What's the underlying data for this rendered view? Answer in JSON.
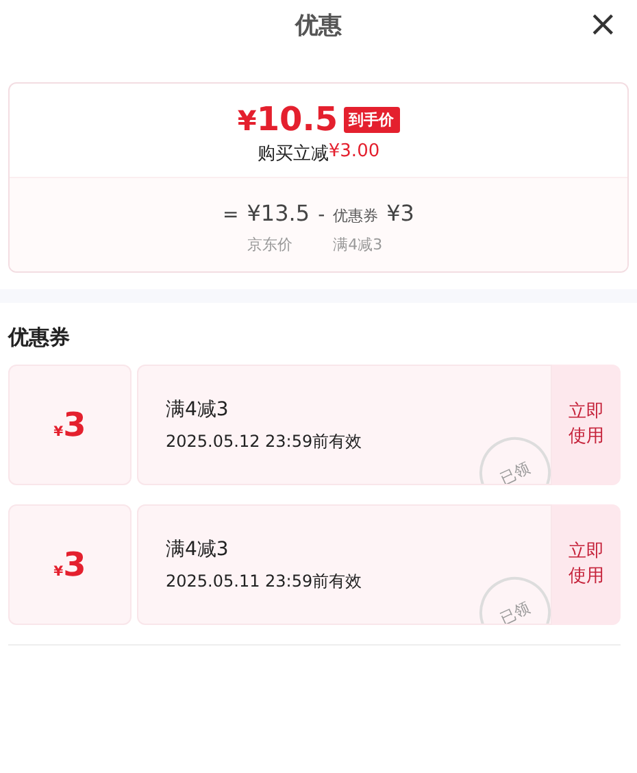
{
  "header": {
    "title": "优惠",
    "close": "×"
  },
  "summary": {
    "currency": "¥",
    "amount": "10.5",
    "badge": "到手价",
    "saving_label": "购买立减",
    "saving_value": "¥3.00",
    "equals": "=",
    "base_price": "¥13.5",
    "minus": "-",
    "coupon_label": "优惠券",
    "coupon_value": "¥3",
    "base_caption": "京东价",
    "coupon_caption": "满4减3"
  },
  "coupons_heading": "优惠券",
  "coupons": [
    {
      "currency": "¥",
      "amount": "3",
      "title": "满4减3",
      "validity": "2025.05.12 23:59前有效",
      "stamp": "已领",
      "action": "立即使用"
    },
    {
      "currency": "¥",
      "amount": "3",
      "title": "满4减3",
      "validity": "2025.05.11 23:59前有效",
      "stamp": "已领",
      "action": "立即使用"
    }
  ]
}
